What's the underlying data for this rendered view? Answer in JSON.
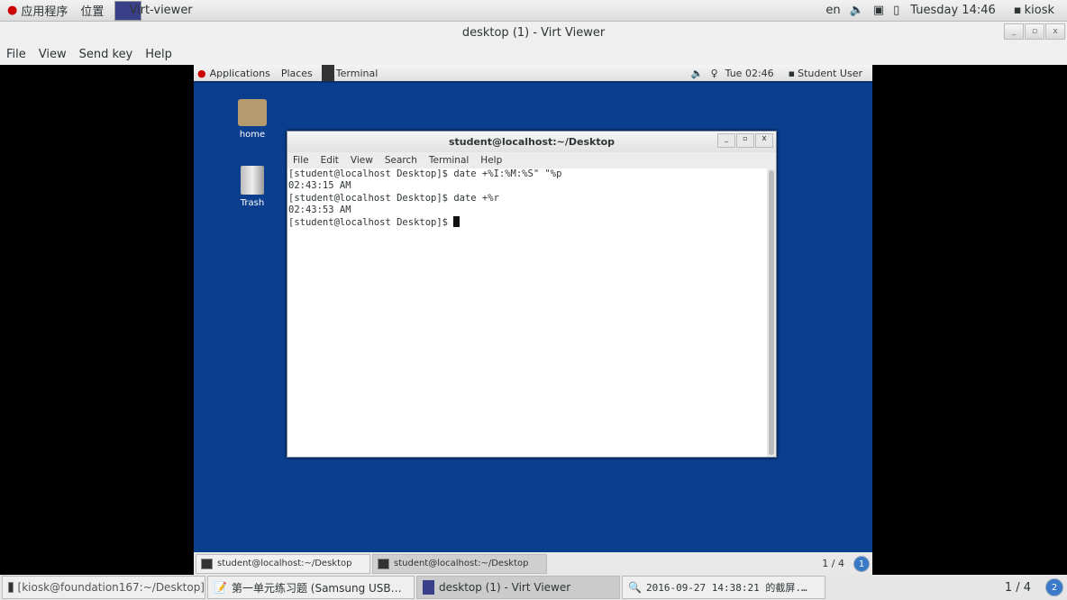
{
  "host_top": {
    "apps": "应用程序",
    "places": "位置",
    "active_app": "Virt-viewer",
    "lang": "en",
    "clock": "Tuesday 14:46",
    "user": "kiosk"
  },
  "window": {
    "title": "desktop (1) - Virt Viewer",
    "min": "_",
    "max": "▫",
    "close": "x",
    "menu": [
      "File",
      "View",
      "Send key",
      "Help"
    ]
  },
  "guest_top": {
    "applications": "Applications",
    "places": "Places",
    "terminal": "Terminal",
    "clock": "Tue 02:46",
    "user": "Student User"
  },
  "desktop_icons": [
    {
      "label": "home",
      "icon": "home-folder-icon"
    },
    {
      "label": "Trash",
      "icon": "trash-icon"
    }
  ],
  "terminal": {
    "title": "student@localhost:~/Desktop",
    "menu": [
      "File",
      "Edit",
      "View",
      "Search",
      "Terminal",
      "Help"
    ],
    "lines": [
      "[student@localhost Desktop]$ date +%I:%M:%S\" \"%p",
      "02:43:15 AM",
      "[student@localhost Desktop]$ date +%r",
      "02:43:53 AM",
      "[student@localhost Desktop]$ "
    ]
  },
  "guest_taskbar": {
    "items": [
      "student@localhost:~/Desktop",
      "student@localhost:~/Desktop"
    ],
    "pager": "1 / 4",
    "workspace": "1"
  },
  "host_taskbar": {
    "items": [
      "[kiosk@foundation167:~/Desktop]",
      "第一单元练习题 (Samsung USB…",
      "desktop (1) - Virt Viewer",
      "2016-09-27 14:38:21 的截屏.…"
    ],
    "pager": "1 / 4",
    "workspace": "2"
  },
  "colors": {
    "desktop": "#0b3e8e"
  }
}
